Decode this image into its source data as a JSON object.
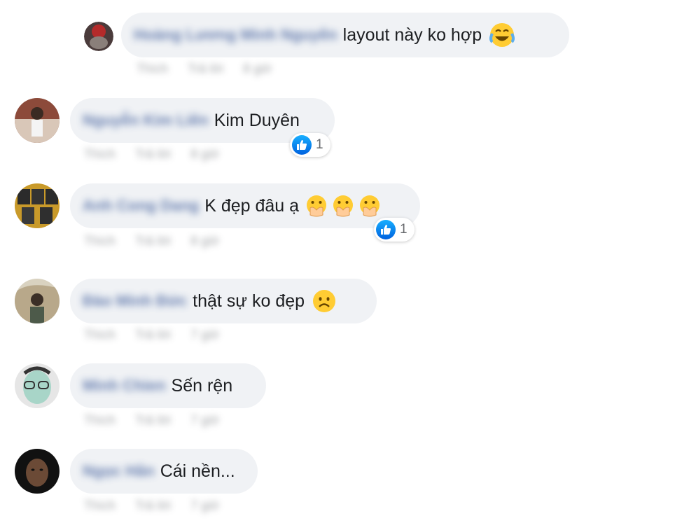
{
  "comments": [
    {
      "author": "Hoàng Lương Minh Nguyên",
      "text": "layout này ko hợp",
      "emojis": [
        "laugh-cry-emoji"
      ],
      "actions": [
        "Thích",
        "Trả lời",
        "8 giờ"
      ],
      "reactions": null
    },
    {
      "author": "Nguyễn Kim Liên",
      "text": "Kim Duyên",
      "emojis": [],
      "actions": [
        "Thích",
        "Trả lời",
        "8 giờ"
      ],
      "reactions": "1"
    },
    {
      "author": "Anh Cong Dang",
      "text": "K đẹp đâu ạ",
      "emojis": [
        "hand-over-mouth-emoji",
        "hand-over-mouth-emoji",
        "hand-over-mouth-emoji"
      ],
      "actions": [
        "Thích",
        "Trả lời",
        "8 giờ"
      ],
      "reactions": "1"
    },
    {
      "author": "Đào Minh Đức",
      "text": "thật sự ko đẹp",
      "emojis": [
        "frowning-face-emoji"
      ],
      "actions": [
        "Thích",
        "Trả lời",
        "7 giờ"
      ],
      "reactions": null
    },
    {
      "author": "Minh Chien",
      "text": "Sến rện",
      "emojis": [],
      "actions": [
        "Thích",
        "Trả lời",
        "7 giờ"
      ],
      "reactions": null
    },
    {
      "author": "Ngọc Hân",
      "text": "Cái nền...",
      "emojis": [],
      "actions": [
        "Thích",
        "Trả lời",
        "7 giờ"
      ],
      "reactions": null
    }
  ],
  "colors": {
    "bubble": "#f0f2f5",
    "author": "#385898",
    "like": "#1877f2"
  }
}
